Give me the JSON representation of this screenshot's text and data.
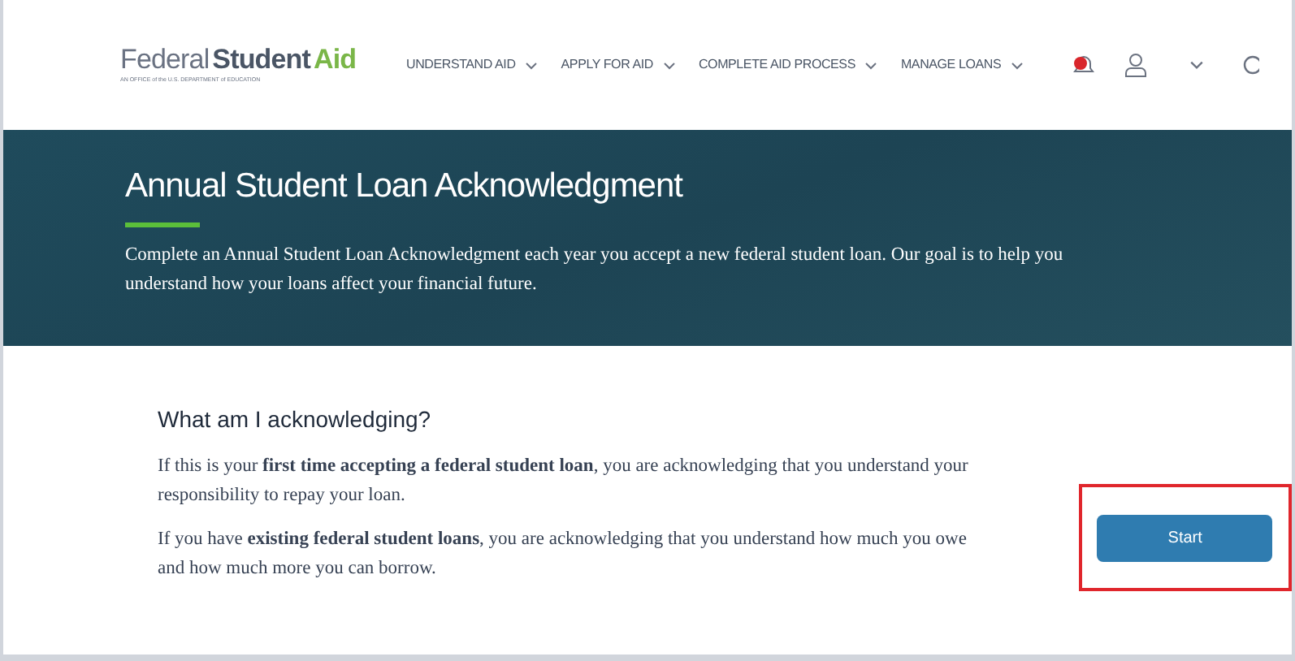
{
  "header": {
    "logo": {
      "word_1": "Federal",
      "word_2": "Student",
      "word_3": "Aid",
      "tagline": "AN OFFICE of the U.S. DEPARTMENT of EDUCATION"
    },
    "nav": [
      {
        "label": "UNDERSTAND AID"
      },
      {
        "label": "APPLY FOR AID"
      },
      {
        "label": "COMPLETE AID PROCESS"
      },
      {
        "label": "MANAGE LOANS"
      }
    ]
  },
  "banner": {
    "title": "Annual Student Loan Acknowledgment",
    "text": "Complete an Annual Student Loan Acknowledgment each year you accept a new federal student loan. Our goal is to help you understand how your loans affect your financial future."
  },
  "section": {
    "heading": "What am I acknowledging?",
    "paragraphs": [
      "If this is your **first time accepting a federal student loan**, you are acknowledging that you understand your responsibility to repay your loan.",
      "If you have **existing federal student loans**, you are acknowledging that you understand how much you owe and how much more you can borrow."
    ],
    "button": {
      "label": "Start",
      "highlighted": true
    }
  }
}
